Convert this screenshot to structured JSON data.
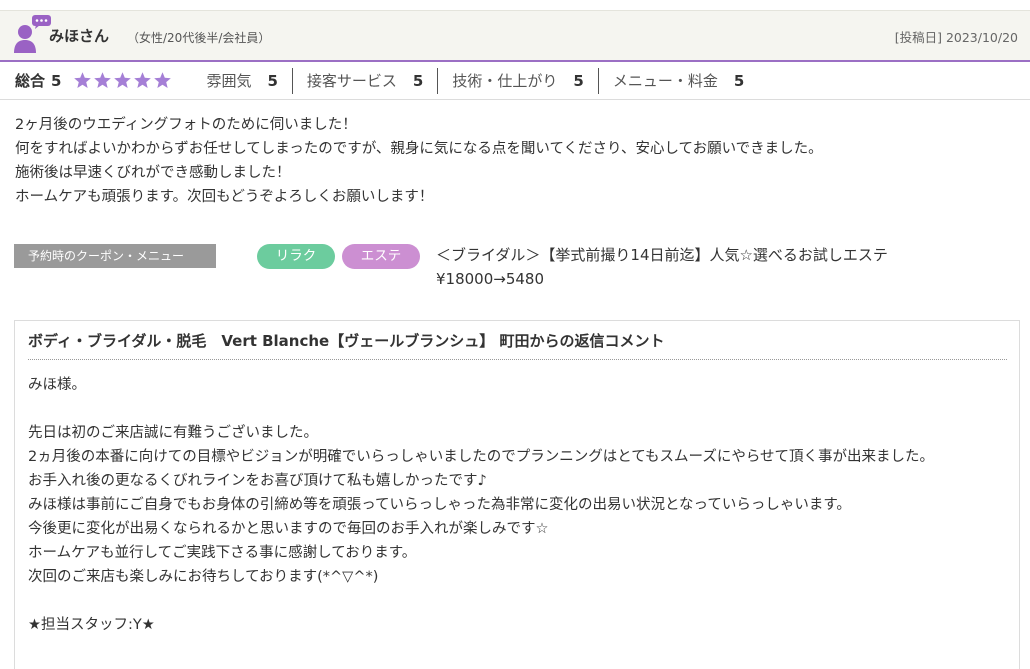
{
  "reviewer": {
    "name": "みほさん",
    "info": "（女性/20代後半/会社員）",
    "posted_date": "[投稿日] 2023/10/20"
  },
  "ratings": {
    "total_label": "総合",
    "total_value": "5",
    "total_stars": 5,
    "items": [
      {
        "label": "雰囲気",
        "value": "5"
      },
      {
        "label": "接客サービス",
        "value": "5"
      },
      {
        "label": "技術・仕上がり",
        "value": "5"
      },
      {
        "label": "メニュー・料金",
        "value": "5"
      }
    ]
  },
  "review": {
    "lines": [
      "2ヶ月後のウエディングフォトのために伺いました！",
      "何をすればよいかわからずお任せしてしまったのですが、親身に気になる点を聞いてくださり、安心してお願いできました。",
      "施術後は早速くびれができ感動しました！",
      "ホームケアも頑張ります。次回もどうぞよろしくお願いします！"
    ]
  },
  "coupon": {
    "label": "予約時のクーポン・メニュー",
    "tags": [
      "リラク",
      "エステ"
    ],
    "title": "＜ブライダル＞【挙式前撮り14日前迄】人気☆選べるお試しエステ",
    "price": "¥18000→5480"
  },
  "reply": {
    "heading": "ボディ・ブライダル・脱毛　Vert Blanche【ヴェールブランシュ】 町田からの返信コメント",
    "lines": [
      "みほ様。",
      "",
      "先日は初のご来店誠に有難うございました。",
      "2ヵ月後の本番に向けての目標やビジョンが明確でいらっしゃいましたのでプランニングはとてもスムーズにやらせて頂く事が出来ました。",
      "お手入れ後の更なるくびれラインをお喜び頂けて私も嬉しかったです♪",
      "みほ様は事前にご自身でもお身体の引締め等を頑張っていらっしゃった為非常に変化の出易い状況となっていらっしゃいます。",
      "今後更に変化が出易くなられるかと思いますので毎回のお手入れが楽しみです☆",
      "ホームケアも並行してご実践下さる事に感謝しております。",
      "次回のご来店も楽しみにお待ちしております(*^▽^*)",
      "",
      "★担当スタッフ:Y★"
    ]
  },
  "colors": {
    "accent_purple": "#9b6fc4",
    "star": "#a57fd6",
    "tag_relax": "#6ccc9e",
    "tag_esthe": "#cc8fd2"
  },
  "icons": [
    "user-avatar-icon",
    "chat-bubble-icon",
    "star-icon"
  ]
}
